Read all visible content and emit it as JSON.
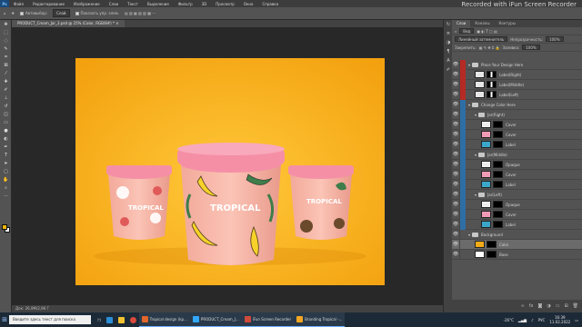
{
  "menu": [
    "Файл",
    "Редактирование",
    "Изображение",
    "Слои",
    "Текст",
    "Выделение",
    "Фильтр",
    "3D",
    "Просмотр",
    "Окно",
    "Справка"
  ],
  "watermark": "Recorded with iFun Screen Recorder",
  "options": {
    "auto_select": "Автовыбор:",
    "target": "Слой",
    "transform": "Показать упр. элем."
  },
  "doc_tab": "PRODUCT_Cream_Jar_3.psd @ 25% (Color, RGB/8#) *",
  "status": "Док: 26,9M/2,96 Г",
  "jar_brand": "TROPICAL",
  "panel": {
    "tabs": [
      "Слои",
      "Каналы",
      "Контуры"
    ],
    "filter": "Вид",
    "blend": "Линейный затемнитель",
    "opacity_label": "Непрозрачность:",
    "opacity": "100%",
    "lock_label": "Закрепить:",
    "fill_label": "Заливка:",
    "fill": "100%"
  },
  "layers": [
    {
      "name": "Place Your Design Here",
      "type": "folder",
      "tag": "red",
      "indent": 0
    },
    {
      "name": "Label(Right)",
      "type": "smart",
      "tag": "red",
      "indent": 1
    },
    {
      "name": "Label(Middle)",
      "type": "smart",
      "tag": "red",
      "indent": 1
    },
    {
      "name": "Label(Left)",
      "type": "smart",
      "tag": "red",
      "indent": 1
    },
    {
      "name": "Change Color Here",
      "type": "folder",
      "tag": "blue",
      "indent": 0
    },
    {
      "name": "Jar(Right)",
      "type": "folder",
      "tag": "blue",
      "indent": 1
    },
    {
      "name": "Cover",
      "type": "fill",
      "color": "#eeeeee",
      "tag": "blue",
      "indent": 2
    },
    {
      "name": "Cover",
      "type": "fill",
      "color": "#f19ab4",
      "tag": "blue",
      "indent": 2
    },
    {
      "name": "Label",
      "type": "fill",
      "color": "#3aa7c9",
      "tag": "blue",
      "indent": 2
    },
    {
      "name": "Jar(Middle)",
      "type": "folder",
      "tag": "blue",
      "indent": 1
    },
    {
      "name": "Opaque",
      "type": "fill",
      "color": "#eeeeee",
      "tag": "blue",
      "indent": 2
    },
    {
      "name": "Cover",
      "type": "fill",
      "color": "#f19ab4",
      "tag": "blue",
      "indent": 2
    },
    {
      "name": "Label",
      "type": "fill",
      "color": "#3aa7c9",
      "tag": "blue",
      "indent": 2
    },
    {
      "name": "Jar(Left)",
      "type": "folder",
      "tag": "blue",
      "indent": 1
    },
    {
      "name": "Opaque",
      "type": "fill",
      "color": "#eeeeee",
      "tag": "blue",
      "indent": 2
    },
    {
      "name": "Cover",
      "type": "fill",
      "color": "#f19ab4",
      "tag": "blue",
      "indent": 2
    },
    {
      "name": "Label",
      "type": "fill",
      "color": "#3aa7c9",
      "tag": "blue",
      "indent": 2
    },
    {
      "name": "Background",
      "type": "folder",
      "tag": "none",
      "indent": 0
    },
    {
      "name": "Color",
      "type": "fill",
      "color": "#f4ab18",
      "tag": "none",
      "indent": 1,
      "selected": true
    },
    {
      "name": "Base",
      "type": "fill",
      "color": "#ffffff",
      "tag": "none",
      "indent": 1
    }
  ],
  "taskbar": {
    "search": "Введите здесь текст для поиска",
    "apps": [
      {
        "label": "Tropical design (kp...",
        "color": "#e0662b"
      },
      {
        "label": "PRODUCT_Cream_J...",
        "color": "#31a8ff"
      },
      {
        "label": "iFun Screen Recorder",
        "color": "#d04a3a"
      },
      {
        "label": "Branding Tropical -...",
        "color": "#f5a623"
      }
    ],
    "temp": "-26°C",
    "lang": "РУС",
    "time": "16:39",
    "date": "11.02.2022"
  }
}
